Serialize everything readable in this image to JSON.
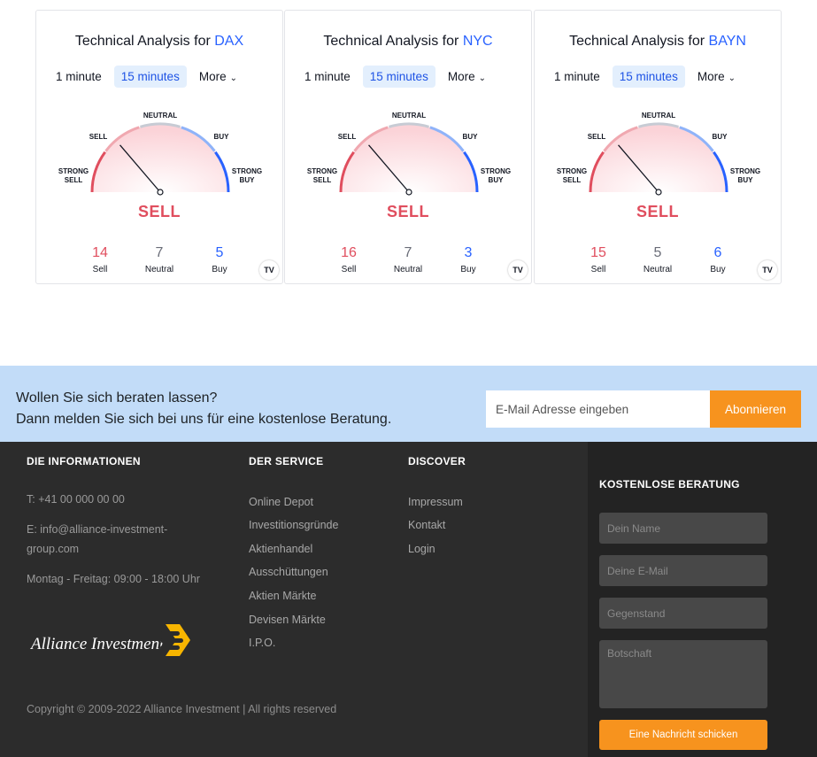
{
  "widgets": [
    {
      "title_prefix": "Technical Analysis for",
      "symbol": "DAX",
      "tabs": [
        "1 minute",
        "15 minutes",
        "More"
      ],
      "active_tab": "15 minutes",
      "gauge_labels": {
        "strong_sell": [
          "STRONG",
          "SELL"
        ],
        "sell": "SELL",
        "neutral": "NEUTRAL",
        "buy": "BUY",
        "strong_buy": [
          "STRONG",
          "BUY"
        ]
      },
      "summary": "SELL",
      "needle_value": -0.45,
      "counts": {
        "sell": 14,
        "neutral": 7,
        "buy": 5
      },
      "count_labels": {
        "sell": "Sell",
        "neutral": "Neutral",
        "buy": "Buy"
      }
    },
    {
      "title_prefix": "Technical Analysis for",
      "symbol": "NYC",
      "tabs": [
        "1 minute",
        "15 minutes",
        "More"
      ],
      "active_tab": "15 minutes",
      "gauge_labels": {
        "strong_sell": [
          "STRONG",
          "SELL"
        ],
        "sell": "SELL",
        "neutral": "NEUTRAL",
        "buy": "BUY",
        "strong_buy": [
          "STRONG",
          "BUY"
        ]
      },
      "summary": "SELL",
      "needle_value": -0.45,
      "counts": {
        "sell": 16,
        "neutral": 7,
        "buy": 3
      },
      "count_labels": {
        "sell": "Sell",
        "neutral": "Neutral",
        "buy": "Buy"
      }
    },
    {
      "title_prefix": "Technical Analysis for",
      "symbol": "BAYN",
      "tabs": [
        "1 minute",
        "15 minutes",
        "More"
      ],
      "active_tab": "15 minutes",
      "gauge_labels": {
        "strong_sell": [
          "STRONG",
          "SELL"
        ],
        "sell": "SELL",
        "neutral": "NEUTRAL",
        "buy": "BUY",
        "strong_buy": [
          "STRONG",
          "BUY"
        ]
      },
      "summary": "SELL",
      "needle_value": -0.45,
      "counts": {
        "sell": 15,
        "neutral": 5,
        "buy": 6
      },
      "count_labels": {
        "sell": "Sell",
        "neutral": "Neutral",
        "buy": "Buy"
      }
    }
  ],
  "newsletter": {
    "line1": "Wollen Sie sich beraten lassen?",
    "line2": "Dann melden Sie sich bei uns für eine kostenlose Beratung.",
    "email_placeholder": "E-Mail Adresse eingeben",
    "button": "Abonnieren"
  },
  "footer": {
    "info": {
      "heading": "DIE INFORMATIONEN",
      "phone": "T: +41 00 000 00 00",
      "email": "E: info@alliance-investment-group.com",
      "hours": "Montag - Freitag: 09:00 - 18:00 Uhr"
    },
    "service": {
      "heading": "DER SERVICE",
      "links": [
        "Online Depot",
        "Investitionsgründe",
        "Aktienhandel",
        "Ausschüttungen",
        "Aktien Märkte",
        "Devisen Märkte",
        "I.P.O."
      ]
    },
    "discover": {
      "heading": "DISCOVER",
      "links": [
        "Impressum",
        "Kontakt",
        "Login"
      ]
    },
    "logo_text": "Alliance Investment",
    "copyright": "Copyright © 2009-2022 Alliance Investment | All rights reserved",
    "contact": {
      "heading": "KOSTENLOSE BERATUNG",
      "name_placeholder": "Dein Name",
      "email_placeholder": "Deine E-Mail",
      "subject_placeholder": "Gegenstand",
      "message_placeholder": "Botschaft",
      "button": "Eine Nachricht schicken"
    }
  },
  "colors": {
    "sell": "#e04e5e",
    "buy": "#2962ff",
    "neutral": "#6a6d78",
    "accent_orange": "#f7931e",
    "newsletter_bg": "#c2dcf8",
    "footer_bg": "#2c2c2c"
  }
}
